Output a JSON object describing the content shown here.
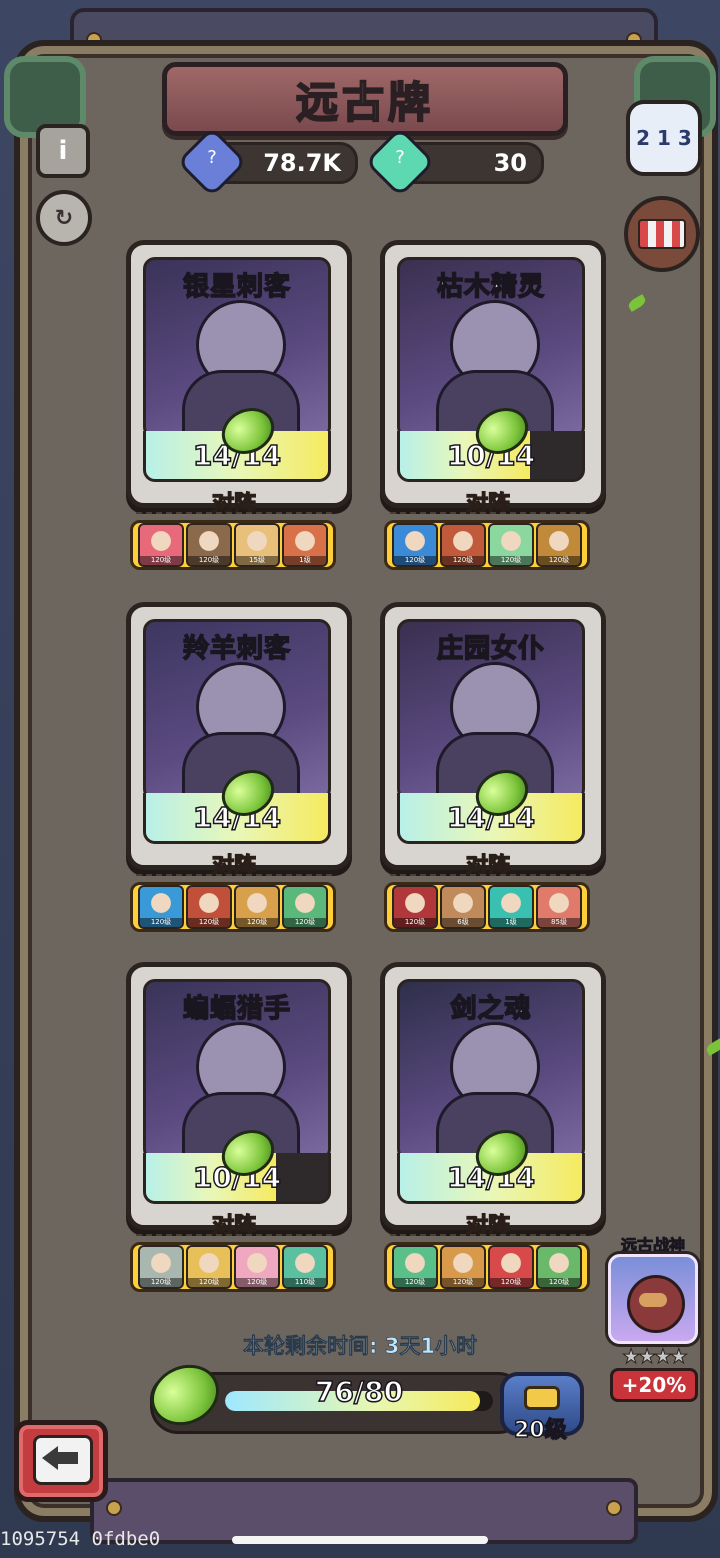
{
  "title": "远古牌",
  "resources": [
    {
      "name": "blue-gem",
      "value": "78.7K",
      "color": "#6a7fd8"
    },
    {
      "name": "green-gem",
      "value": "30",
      "color": "#5ed8b0"
    }
  ],
  "cards": [
    {
      "name": "银星刺客",
      "progress": "14/14",
      "ratio": 1.0,
      "formation": "对阵",
      "team": [
        {
          "lvl": "120级",
          "c": "#e86a7a"
        },
        {
          "lvl": "120级",
          "c": "#8a6a4a"
        },
        {
          "lvl": "15级",
          "c": "#e8c07a"
        },
        {
          "lvl": "1级",
          "c": "#d8704a"
        }
      ],
      "art": "#3a3358"
    },
    {
      "name": "枯木精灵",
      "progress": "10/14",
      "ratio": 0.714,
      "formation": "对阵",
      "team": [
        {
          "lvl": "120级",
          "c": "#3a8ad8"
        },
        {
          "lvl": "120级",
          "c": "#c05a3a"
        },
        {
          "lvl": "120级",
          "c": "#8ad8a0"
        },
        {
          "lvl": "120级",
          "c": "#c08a3a"
        }
      ],
      "art": "#3b3050"
    },
    {
      "name": "羚羊刺客",
      "progress": "14/14",
      "ratio": 1.0,
      "formation": "对阵",
      "team": [
        {
          "lvl": "120级",
          "c": "#3a9ad8"
        },
        {
          "lvl": "120级",
          "c": "#c0503a"
        },
        {
          "lvl": "120级",
          "c": "#d8a04a"
        },
        {
          "lvl": "120级",
          "c": "#5ab87a"
        }
      ],
      "art": "#3d3760"
    },
    {
      "name": "庄园女仆",
      "progress": "14/14",
      "ratio": 1.0,
      "formation": "对阵",
      "team": [
        {
          "lvl": "120级",
          "c": "#b0383a"
        },
        {
          "lvl": "6级",
          "c": "#c08a5a"
        },
        {
          "lvl": "1级",
          "c": "#3ac0b0"
        },
        {
          "lvl": "85级",
          "c": "#e07a6a"
        }
      ],
      "art": "#3a3050"
    },
    {
      "name": "蝙蝠猎手",
      "progress": "10/14",
      "ratio": 0.714,
      "formation": "对阵",
      "team": [
        {
          "lvl": "120级",
          "c": "#a8b8b0"
        },
        {
          "lvl": "120级",
          "c": "#e8c05a"
        },
        {
          "lvl": "120级",
          "c": "#f0a8c0"
        },
        {
          "lvl": "110级",
          "c": "#5ac0a0"
        }
      ],
      "art": "#3a3458"
    },
    {
      "name": "剑之魂",
      "progress": "14/14",
      "ratio": 1.0,
      "formation": "对阵",
      "team": [
        {
          "lvl": "120级",
          "c": "#5ac08a"
        },
        {
          "lvl": "120级",
          "c": "#d89a4a"
        },
        {
          "lvl": "120级",
          "c": "#d84a4a"
        },
        {
          "lvl": "120级",
          "c": "#6ab86a"
        }
      ],
      "art": "#2f2f4a"
    }
  ],
  "timer": "本轮剩余时间: 3天1小时",
  "main_progress": {
    "text": "76/80",
    "ratio": 0.95
  },
  "chest": {
    "level": "20级"
  },
  "boss": {
    "name": "远古战神",
    "stars": "★★★★",
    "bonus": "+20%"
  },
  "debug": "1095754 0fdbe0",
  "icons": {
    "info": "info-icon",
    "refresh": "refresh-icon",
    "rank": "podium-icon",
    "shop": "shop-icon",
    "back": "back-arrow-icon"
  }
}
